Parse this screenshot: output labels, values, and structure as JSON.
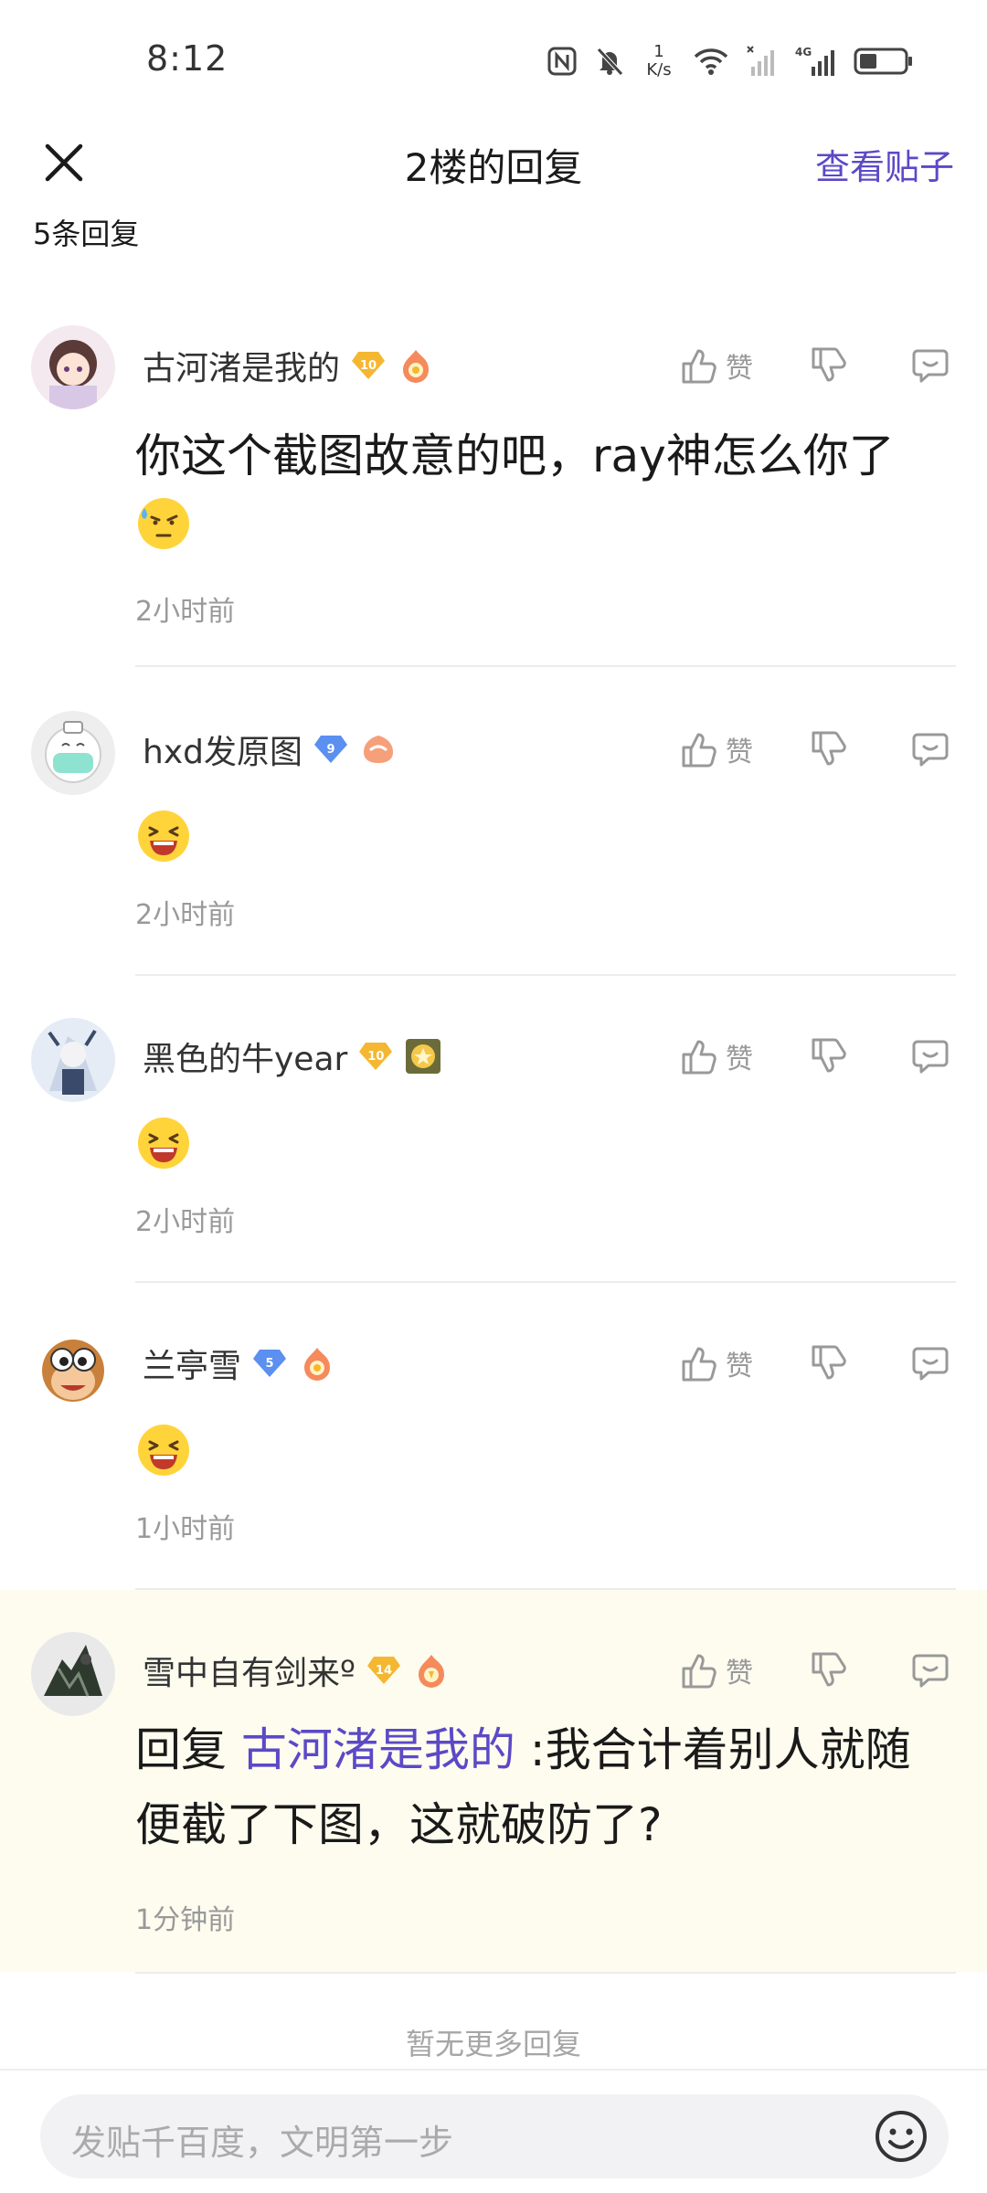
{
  "status": {
    "time": "8:12",
    "net_speed_value": "1",
    "net_speed_unit": "K/s",
    "network_type": "4G"
  },
  "header": {
    "title": "2楼的回复",
    "view_post": "查看贴子"
  },
  "reply_count": "5条回复",
  "like_label": "赞",
  "comments": [
    {
      "username": "古河渚是我的",
      "level": "10",
      "level_color": "#f5b731",
      "content": "你这个截图故意的吧，ray神怎么你了",
      "emoji": "sweat-thinking-emoji",
      "time": "2小时前"
    },
    {
      "username": "hxd发原图",
      "level": "9",
      "level_color": "#5b8ff0",
      "emoji": "laughing-emoji",
      "time": "2小时前"
    },
    {
      "username": "黑色的牛year",
      "level": "10",
      "level_color": "#f5b731",
      "emoji": "laughing-emoji",
      "time": "2小时前"
    },
    {
      "username": "兰亭雪",
      "level": "5",
      "level_color": "#5b8ff0",
      "emoji": "laughing-emoji",
      "time": "1小时前"
    },
    {
      "username": "雪中自有剑来º",
      "level": "14",
      "level_color": "#f5b731",
      "reply_prefix": "回复 ",
      "reply_target": "古河渚是我的",
      "content": " :我合计着别人就随便截了下图，这就破防了?",
      "time": "1分钟前",
      "highlight_color": "#fdfcef"
    }
  ],
  "no_more": "暂无更多回复",
  "input": {
    "placeholder": "发贴千百度，文明第一步"
  },
  "colors": {
    "accent": "#5b49c6",
    "muted": "#999999"
  }
}
